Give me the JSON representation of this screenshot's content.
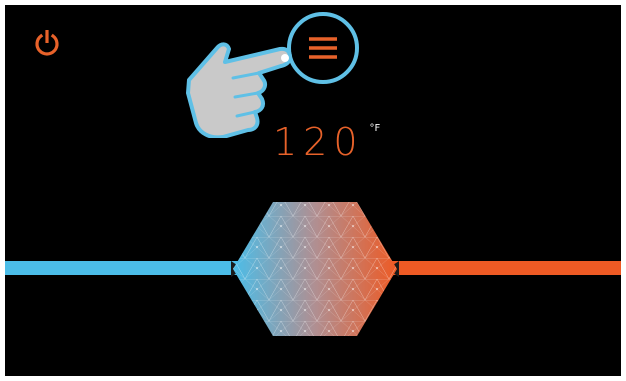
{
  "temperature": {
    "value": "120",
    "unit": "°F"
  },
  "icons": {
    "power": "power-icon",
    "menu": "hamburger-menu-icon",
    "hand": "pointing-hand-icon"
  },
  "slider": {
    "cold_color": "#4bbde8",
    "hot_color": "#ee5a24",
    "position": 0.5
  },
  "colors": {
    "accent": "#e8622a",
    "highlight": "#5fc0e6",
    "background": "#000000"
  }
}
